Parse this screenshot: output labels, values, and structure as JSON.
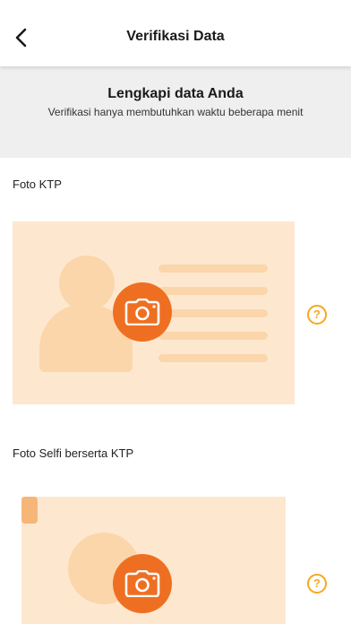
{
  "header": {
    "back_icon": "chevron-left-icon",
    "title": "Verifikasi Data"
  },
  "banner": {
    "title": "Lengkapi data Anda",
    "subtitle": "Verifikasi hanya membutuhkan waktu beberapa menit"
  },
  "sections": [
    {
      "label": "Foto KTP",
      "illustration": "id-card",
      "action_icon": "camera-icon",
      "help_icon": "help-icon",
      "help_text": "?"
    },
    {
      "label": "Foto Selfi berserta KTP",
      "illustration": "selfie-with-id",
      "action_icon": "camera-icon",
      "help_icon": "help-icon",
      "help_text": "?"
    }
  ],
  "colors": {
    "accent": "#ef6f22",
    "help": "#f5a91d",
    "card_bg": "#fde8cf",
    "illustration": "#fbd6ab",
    "banner_bg": "#efefef"
  }
}
